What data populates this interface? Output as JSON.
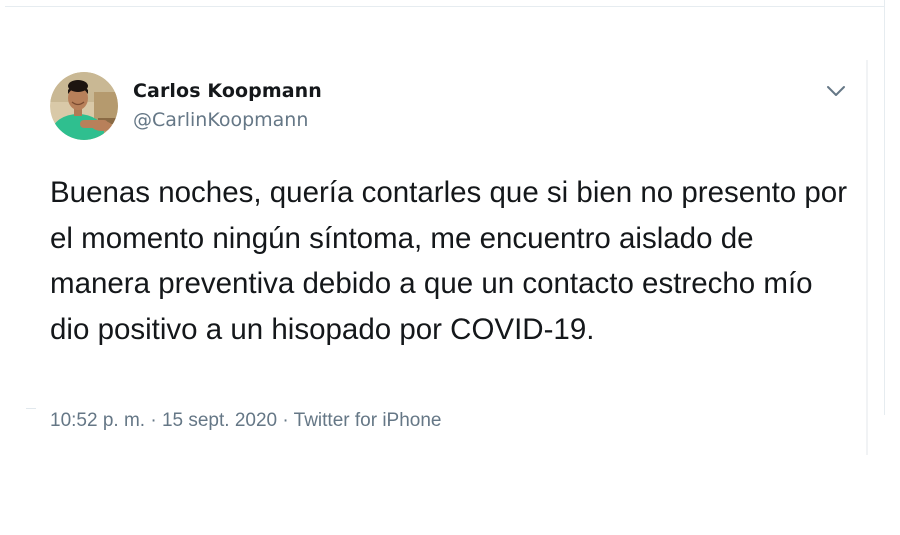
{
  "tweet": {
    "author": {
      "name": "Carlos Koopmann",
      "handle": "@CarlinKoopmann"
    },
    "text": "Buenas noches, quería contarles que si bien no presento por el momento ningún síntoma, me encuentro aislado de manera preventiva debido a que un contacto estrecho mío dio positivo a un hisopado por COVID-19.",
    "meta": {
      "time": "10:52 p. m.",
      "separator": "·",
      "date": "15 sept. 2020",
      "source": "Twitter for iPhone"
    },
    "icons": {
      "menu": "chevron-down-icon",
      "avatar": "profile-photo"
    },
    "colors": {
      "text": "#14171a",
      "secondary": "#657786",
      "border": "#e6ecf0"
    }
  }
}
